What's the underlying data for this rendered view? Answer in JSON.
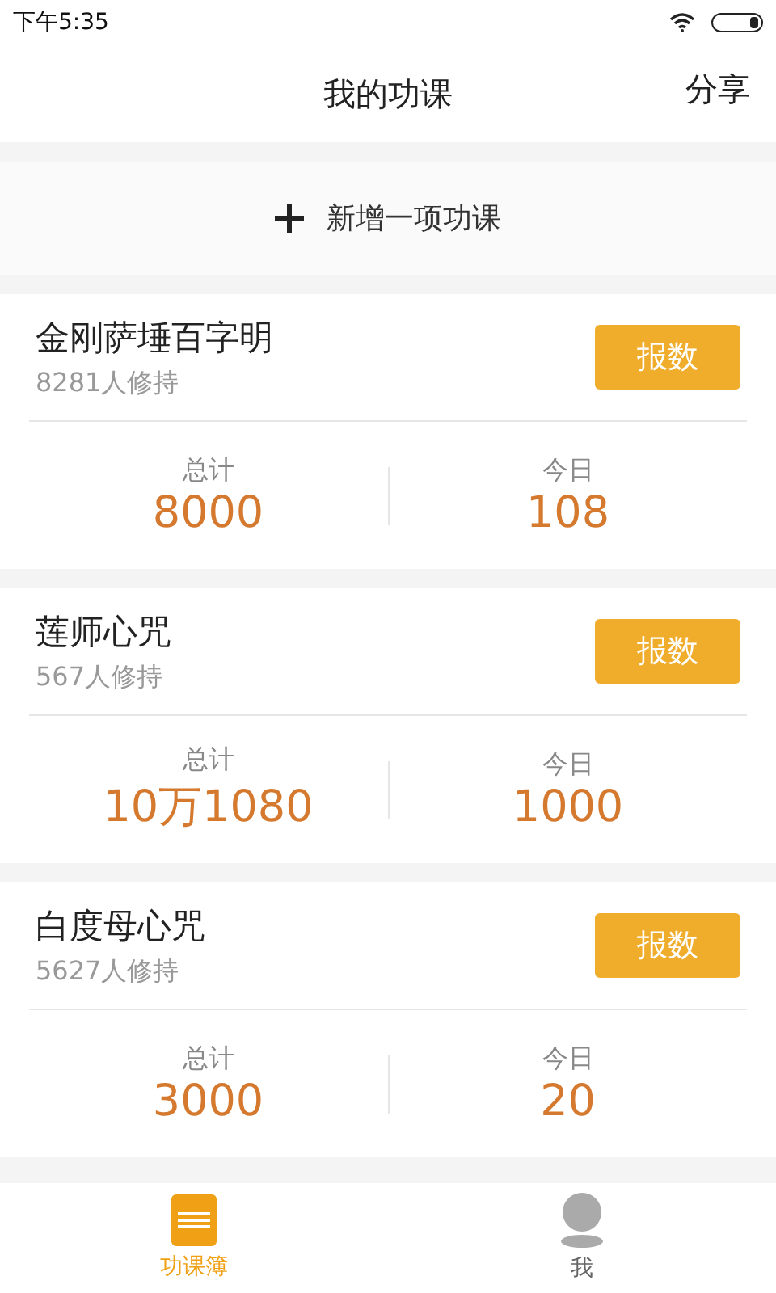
{
  "status_bar": {
    "time": "下午5:35"
  },
  "header": {
    "title": "我的功课",
    "action": "分享"
  },
  "add_button": {
    "label": "新增一项功课"
  },
  "courses": [
    {
      "name": "金刚萨埵百字明",
      "practitioners": "8281人修持",
      "button": "报数",
      "total_label": "总计",
      "total": "8000",
      "today_label": "今日",
      "today": "108"
    },
    {
      "name": "莲师心咒",
      "practitioners": "567人修持",
      "button": "报数",
      "total_label": "总计",
      "total": "10万1080",
      "today_label": "今日",
      "today": "1000"
    },
    {
      "name": "白度母心咒",
      "practitioners": "5627人修持",
      "button": "报数",
      "total_label": "总计",
      "total": "3000",
      "today_label": "今日",
      "today": "20"
    }
  ],
  "tabs": [
    {
      "kind": "book",
      "label": "功课簿",
      "selected": true
    },
    {
      "kind": "person",
      "label": "我",
      "selected": false
    }
  ]
}
